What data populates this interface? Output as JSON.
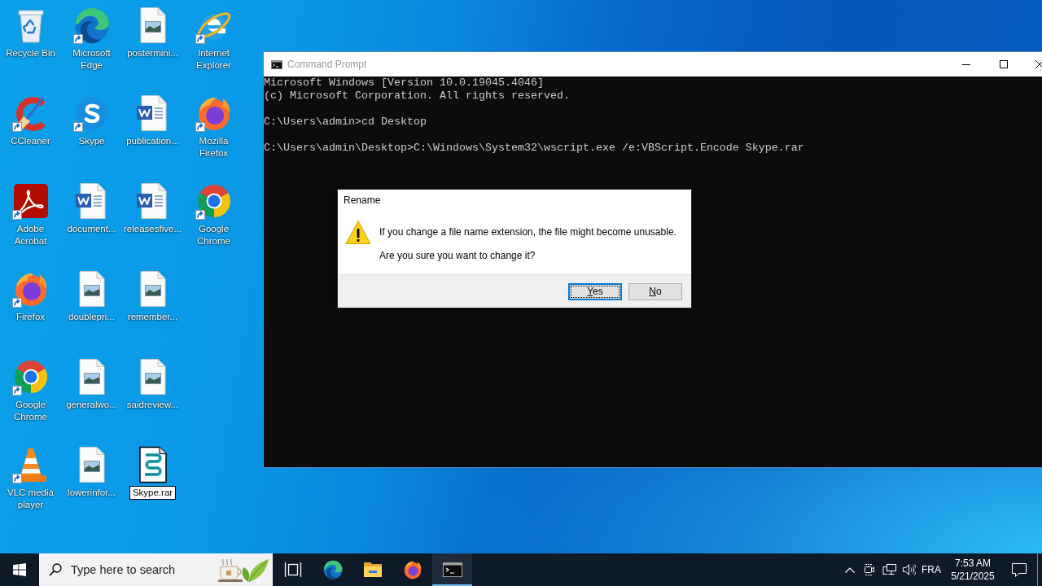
{
  "desktop": {
    "icon_rows": [
      {
        "icons": [
          {
            "kind": "recycle-bin",
            "label": "Recycle Bin",
            "shortcut": false,
            "renaming": false
          },
          {
            "kind": "edge",
            "label": "Microsoft Edge",
            "shortcut": true,
            "renaming": false
          },
          {
            "kind": "image-file",
            "label": "postermini...",
            "shortcut": false,
            "renaming": false
          },
          {
            "kind": "internet-explorer",
            "label": "Internet Explorer",
            "shortcut": true,
            "renaming": false
          }
        ]
      },
      {
        "icons": [
          {
            "kind": "ccleaner",
            "label": "CCleaner",
            "shortcut": true,
            "renaming": false
          },
          {
            "kind": "skype",
            "label": "Skype",
            "shortcut": true,
            "renaming": false
          },
          {
            "kind": "word-document",
            "label": "publication...",
            "shortcut": false,
            "renaming": false
          },
          {
            "kind": "firefox",
            "label": "Mozilla Firefox",
            "shortcut": true,
            "renaming": false
          }
        ]
      },
      {
        "icons": [
          {
            "kind": "acrobat",
            "label": "Adobe Acrobat",
            "shortcut": true,
            "renaming": false
          },
          {
            "kind": "word-document",
            "label": "document...",
            "shortcut": false,
            "renaming": false
          },
          {
            "kind": "word-document",
            "label": "releasesfive...",
            "shortcut": false,
            "renaming": false
          },
          {
            "kind": "chrome",
            "label": "Google Chrome",
            "shortcut": true,
            "renaming": false
          }
        ]
      },
      {
        "icons": [
          {
            "kind": "firefox",
            "label": "Firefox",
            "shortcut": true,
            "renaming": false
          },
          {
            "kind": "image-file",
            "label": "doublepri...",
            "shortcut": false,
            "renaming": false
          },
          {
            "kind": "image-file",
            "label": "remember...",
            "shortcut": false,
            "renaming": false
          }
        ]
      },
      {
        "icons": [
          {
            "kind": "chrome",
            "label": "Google Chrome",
            "shortcut": true,
            "renaming": false
          },
          {
            "kind": "image-file",
            "label": "generalwo...",
            "shortcut": false,
            "renaming": false
          },
          {
            "kind": "image-file",
            "label": "saidreview...",
            "shortcut": false,
            "renaming": false
          }
        ]
      },
      {
        "icons": [
          {
            "kind": "vlc",
            "label": "VLC media player",
            "shortcut": true,
            "renaming": false
          },
          {
            "kind": "image-file",
            "label": "lowerinfor...",
            "shortcut": false,
            "renaming": false
          },
          {
            "kind": "script-file",
            "label": "Skype.rar",
            "shortcut": false,
            "renaming": true
          }
        ]
      }
    ]
  },
  "command_prompt": {
    "title": "Command Prompt",
    "active": false,
    "blocks": [
      [
        "Microsoft Windows [Version 10.0.19045.4046]",
        "(c) Microsoft Corporation. All rights reserved."
      ],
      [
        "C:\\Users\\admin>cd Desktop"
      ],
      [
        "C:\\Users\\admin\\Desktop>C:\\Windows\\System32\\wscript.exe /e:VBScript.Encode Skype.rar"
      ]
    ]
  },
  "dialog": {
    "title": "Rename",
    "message": "If you change a file name extension, the file might become unusable.",
    "question": "Are you sure you want to change it?",
    "buttons": [
      {
        "label": "Yes",
        "focused": true
      },
      {
        "label": "No",
        "focused": false
      }
    ]
  },
  "taskbar": {
    "search": {
      "placeholder": "Type here to search"
    },
    "apps": [
      {
        "kind": "task-view",
        "active": false
      },
      {
        "kind": "edge",
        "active": false
      },
      {
        "kind": "file-explorer",
        "active": false
      },
      {
        "kind": "firefox",
        "active": false
      },
      {
        "kind": "command-prompt",
        "active": true
      }
    ],
    "tray": {
      "language": "FRA",
      "time": "7:53 AM",
      "date": "5/21/2025"
    }
  }
}
